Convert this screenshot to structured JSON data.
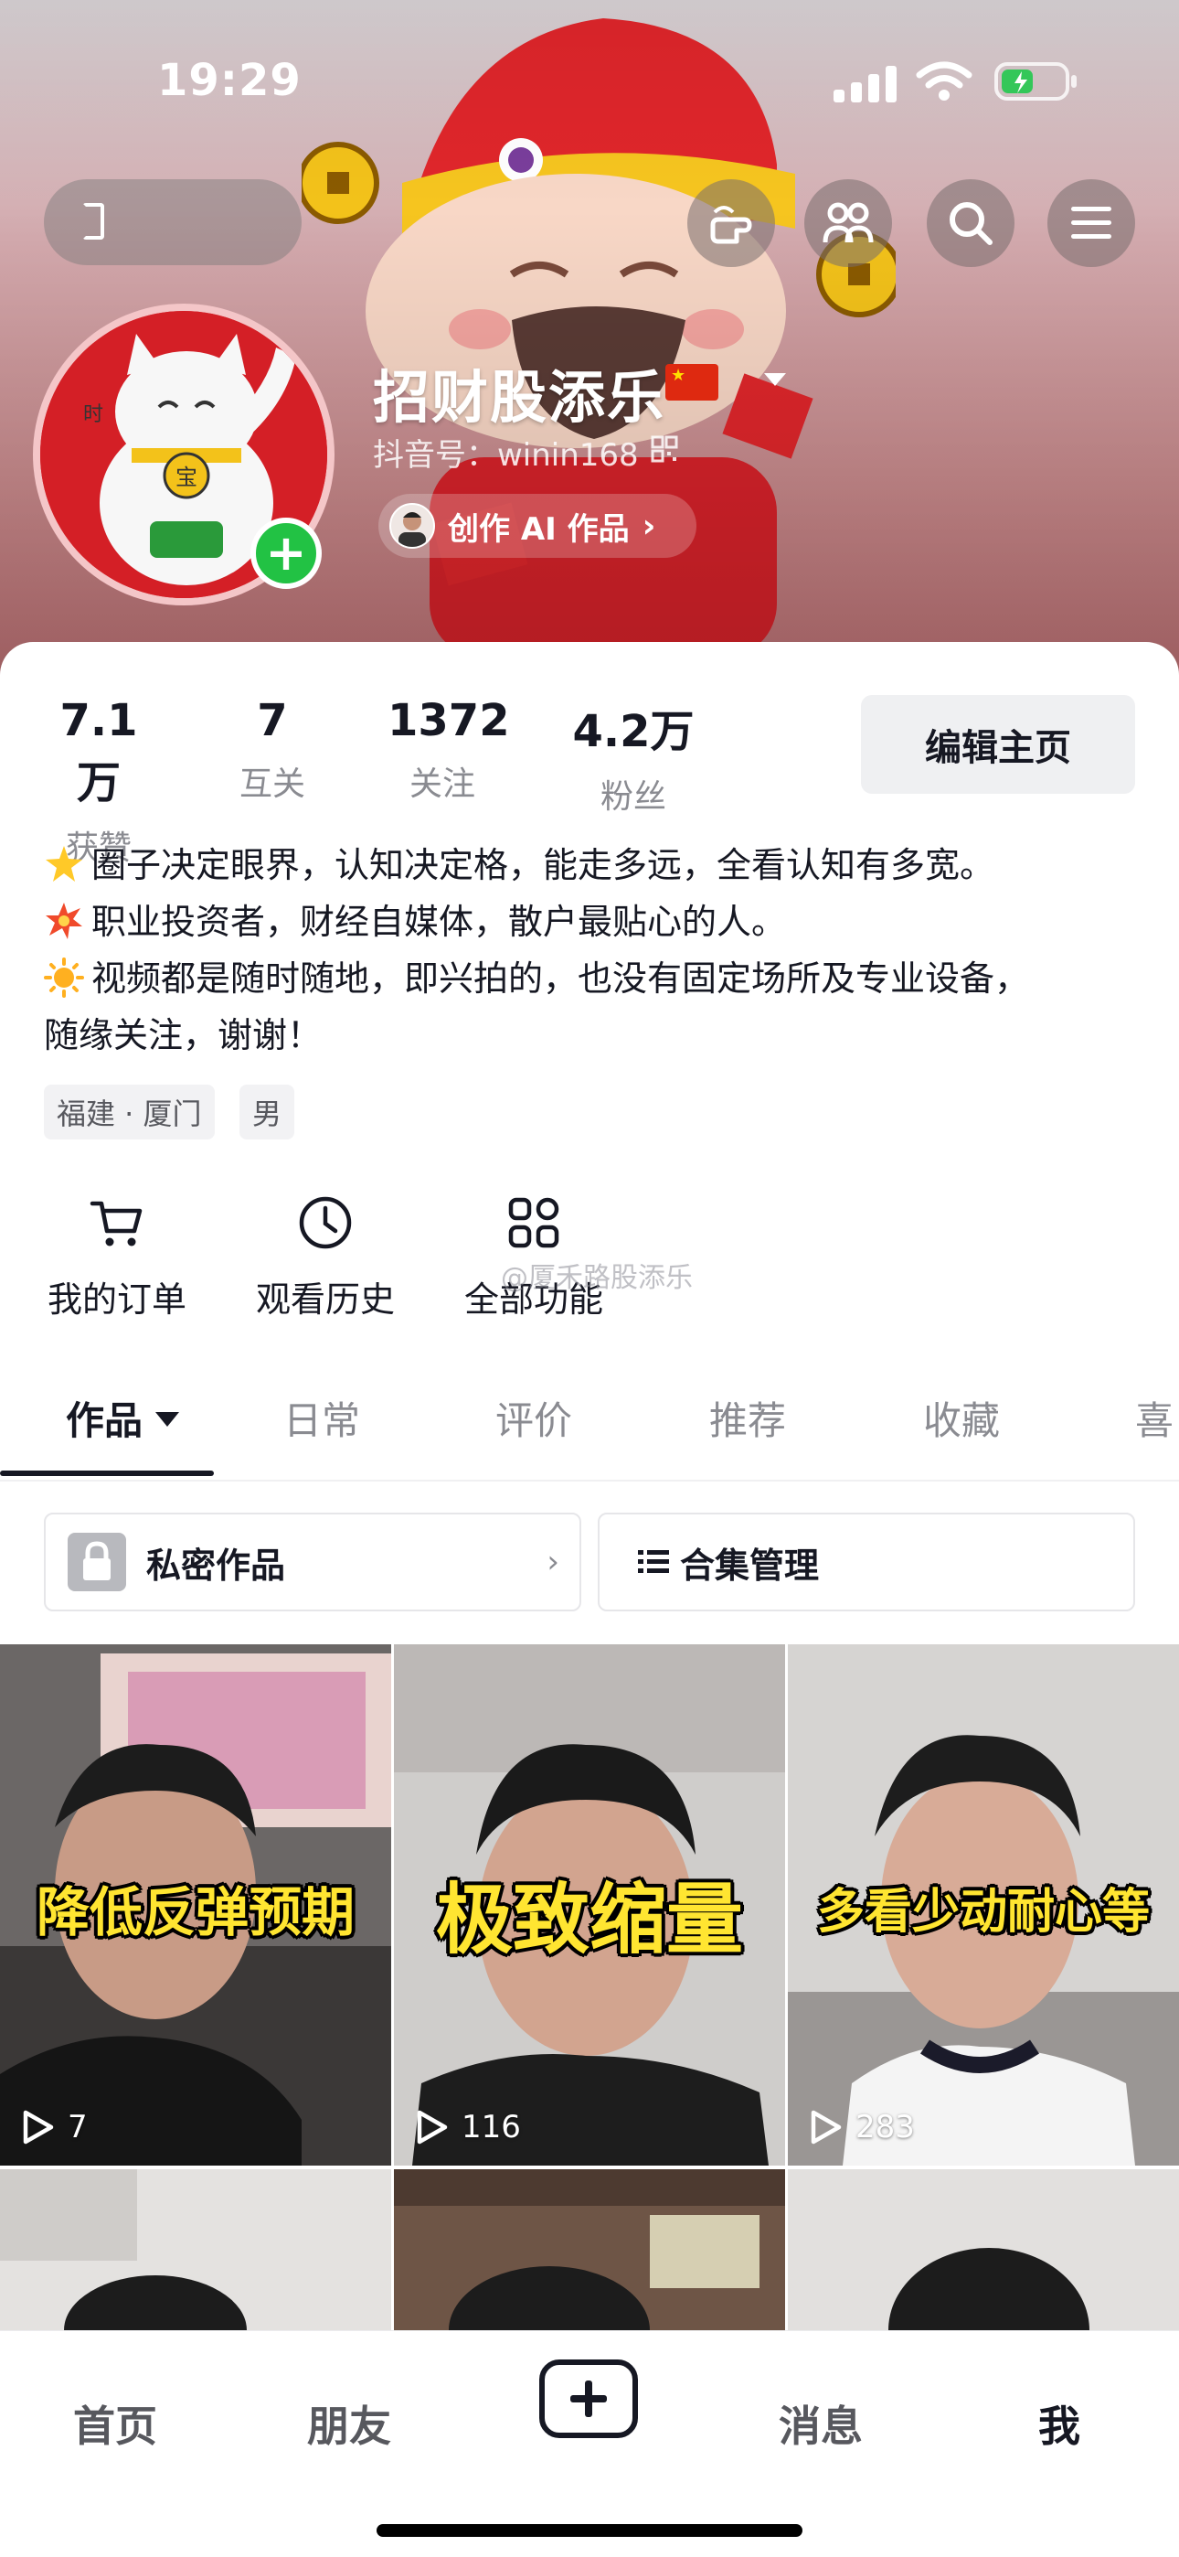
{
  "status_bar": {
    "time": "19:29"
  },
  "profile": {
    "nickname": "招财股添乐",
    "douyin_id": "抖音号：winin168",
    "ai_works_label": "创作 AI 作品"
  },
  "stats": [
    {
      "value": "7.1万",
      "label": "获赞"
    },
    {
      "value": "7",
      "label": "互关"
    },
    {
      "value": "1372",
      "label": "关注"
    },
    {
      "value": "4.2万",
      "label": "粉丝"
    }
  ],
  "edit_button": "编辑主页",
  "bio": {
    "line1": "圈子决定眼界，认知决定格，能走多远，全看认知有多宽。",
    "line2": "职业投资者，财经自媒体，散户最贴心的人。",
    "line3": "视频都是随时随地，即兴拍的，也没有固定场所及专业设备，",
    "line4": "随缘关注，谢谢！"
  },
  "tags": [
    "福建 · 厦门",
    "男"
  ],
  "functions": [
    {
      "label": "我的订单",
      "icon": "cart-icon"
    },
    {
      "label": "观看历史",
      "icon": "clock-icon"
    },
    {
      "label": "全部功能",
      "icon": "grid-icon"
    }
  ],
  "watermark": "@厦禾路股添乐",
  "tabs": [
    "作品",
    "日常",
    "评价",
    "推荐",
    "收藏",
    "喜"
  ],
  "sub_buttons": {
    "private": "私密作品",
    "collection": "合集管理"
  },
  "videos": [
    {
      "caption": "降低反弹预期",
      "plays": "7"
    },
    {
      "caption": "极致缩量",
      "plays": "116"
    },
    {
      "caption": "多看少动耐心等",
      "plays": "283"
    }
  ],
  "bottom_nav": [
    "首页",
    "朋友",
    "消息",
    "我"
  ],
  "colors": {
    "accent_green": "#22c244",
    "text_primary": "#161823",
    "text_secondary": "#8a8b91",
    "caption_yellow": "#ffe531"
  }
}
